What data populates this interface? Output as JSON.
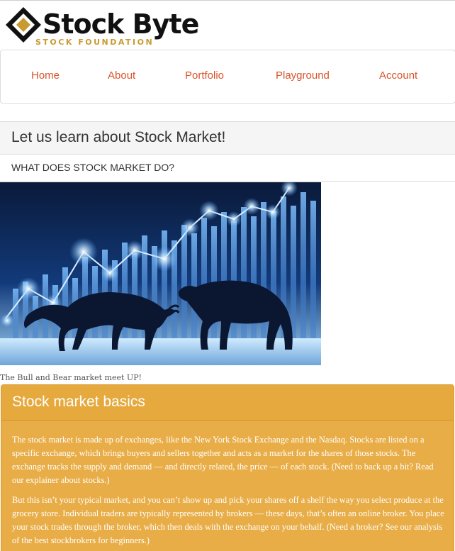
{
  "brand": {
    "name": "Stock Byte",
    "tagline": "STOCK FOUNDATION",
    "colors": {
      "gold": "#c99a2e",
      "dark": "#111111"
    }
  },
  "nav": {
    "items": [
      {
        "label": "Home"
      },
      {
        "label": "About"
      },
      {
        "label": "Portfolio"
      },
      {
        "label": "Playground"
      },
      {
        "label": "Account"
      }
    ],
    "link_color": "#d9532b"
  },
  "page": {
    "title": "Let us learn about Stock Market!",
    "subtitle": "WHAT DOES STOCK MARKET DO?"
  },
  "hero": {
    "image_description_icon": "bull-and-bear-chart-image",
    "caption": "The Bull and Bear market meet UP!"
  },
  "panel": {
    "title": "Stock market basics",
    "background": "#e8ad47",
    "paragraphs": [
      "The stock market is made up of exchanges, like the New York Stock Exchange and the Nasdaq. Stocks are listed on a specific exchange, which brings buyers and sellers together and acts as a market for the shares of those stocks. The exchange tracks the supply and demand — and directly related, the price — of each stock. (Need to back up a bit? Read our explainer about stocks.)",
      "But this isn’t your typical market, and you can’t show up and pick your shares off a shelf the way you select produce at the grocery store. Individual traders are typically represented by brokers — these days, that’s often an online broker. You place your stock trades through the broker, which then deals with the exchange on your behalf. (Need a broker? See our analysis of the best stockbrokers for beginners.)"
    ]
  }
}
